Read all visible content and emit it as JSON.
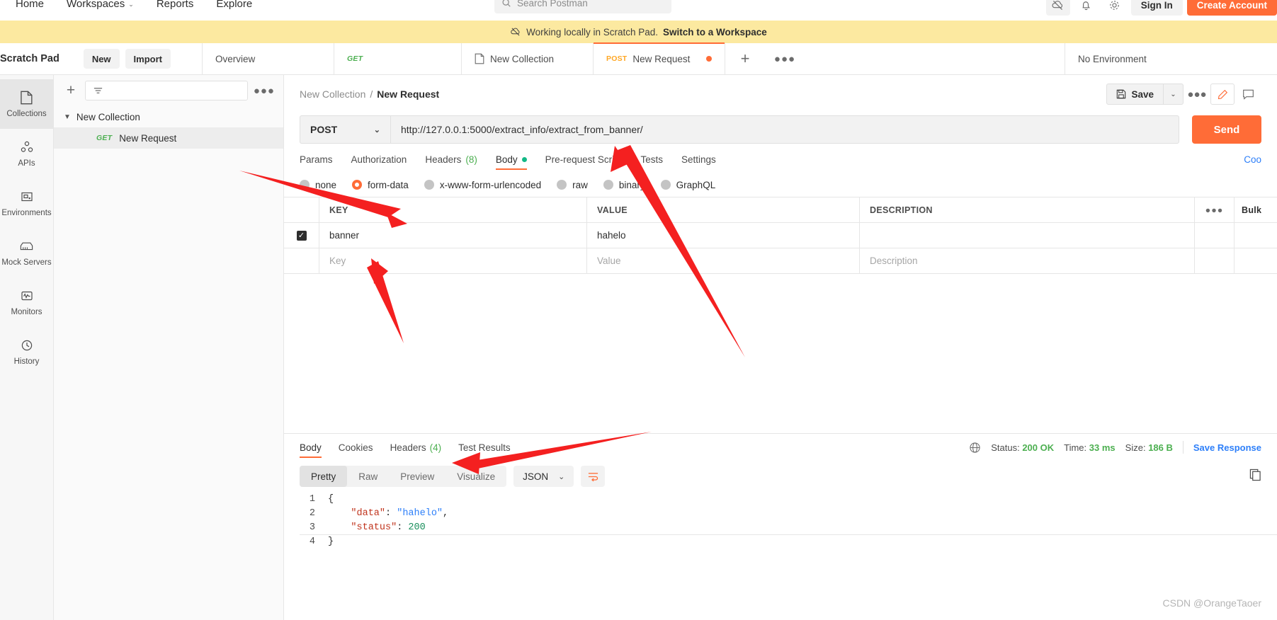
{
  "topnav": {
    "items": [
      {
        "label": "Home",
        "caret": false
      },
      {
        "label": "Workspaces",
        "caret": true
      },
      {
        "label": "Reports",
        "caret": false
      },
      {
        "label": "Explore",
        "caret": false
      }
    ],
    "caret_glyph": "⌄",
    "search_placeholder": "Search Postman",
    "search_icon": "search-icon",
    "sign_in": "Sign In",
    "create_account": "Create Account"
  },
  "banner": {
    "text": "Working locally in Scratch Pad.",
    "link": "Switch to a Workspace",
    "icon": "cloud-offline-icon",
    "color": "#fce9a0"
  },
  "header": {
    "scratch_pad_title": "Scratch Pad",
    "new_button": "New",
    "import_button": "Import",
    "more_icon": "more-horizontal-icon",
    "environment": "No Environment"
  },
  "tabs": [
    {
      "label": "Overview",
      "method": "",
      "icon": "",
      "active": false,
      "dirty": false
    },
    {
      "label": "",
      "method": "GET",
      "icon": "",
      "active": false,
      "dirty": false
    },
    {
      "label": "New Collection",
      "method": "",
      "icon": "collection-icon",
      "active": false,
      "dirty": false
    },
    {
      "label": "New Request",
      "method": "POST",
      "icon": "",
      "active": true,
      "dirty": true
    }
  ],
  "rail": [
    {
      "label": "Collections",
      "icon": "collections-icon",
      "active": true
    },
    {
      "label": "APIs",
      "icon": "apis-icon",
      "active": false
    },
    {
      "label": "Environments",
      "icon": "environments-icon",
      "active": false
    },
    {
      "label": "Mock Servers",
      "icon": "mock-servers-icon",
      "active": false
    },
    {
      "label": "Monitors",
      "icon": "monitors-icon",
      "active": false
    },
    {
      "label": "History",
      "icon": "history-icon",
      "active": false
    }
  ],
  "sidebar": {
    "filter_placeholder": "",
    "plus_icon": "plus-icon",
    "filter_icon": "filter-icon",
    "more_icon": "more-horizontal-icon",
    "collection": "New Collection",
    "request": {
      "method": "GET",
      "name": "New Request"
    }
  },
  "breadcrumb": {
    "collection": "New Collection",
    "separator": "/",
    "request": "New Request",
    "save_label": "Save",
    "save_icon": "save-disk-icon",
    "save_caret": "⌄",
    "more_icon": "more-horizontal-icon",
    "edit_icon": "pencil-icon",
    "comment_icon": "comment-icon"
  },
  "request": {
    "method": "POST",
    "method_caret": "⌄",
    "url": "http://127.0.0.1:5000/extract_info/extract_from_banner/",
    "send_label": "Send",
    "tabs": [
      {
        "label": "Params",
        "count": "",
        "active": false,
        "dot": false
      },
      {
        "label": "Authorization",
        "count": "",
        "active": false,
        "dot": false
      },
      {
        "label": "Headers",
        "count": "(8)",
        "active": false,
        "dot": false
      },
      {
        "label": "Body",
        "count": "",
        "active": true,
        "dot": true
      },
      {
        "label": "Pre-request Script",
        "count": "",
        "active": false,
        "dot": false
      },
      {
        "label": "Tests",
        "count": "",
        "active": false,
        "dot": false
      },
      {
        "label": "Settings",
        "count": "",
        "active": false,
        "dot": false
      }
    ],
    "cookies_link": "Coo",
    "body_types": [
      {
        "label": "none",
        "selected": false
      },
      {
        "label": "form-data",
        "selected": true
      },
      {
        "label": "x-www-form-urlencoded",
        "selected": false
      },
      {
        "label": "raw",
        "selected": false
      },
      {
        "label": "binary",
        "selected": false
      },
      {
        "label": "GraphQL",
        "selected": false
      }
    ],
    "table": {
      "headers": [
        "KEY",
        "VALUE",
        "DESCRIPTION"
      ],
      "more_icon": "more-horizontal-icon",
      "bulk_label": "Bulk",
      "rows": [
        {
          "checked": true,
          "key": "banner",
          "value": "hahelo",
          "description": "",
          "placeholder": false
        }
      ],
      "placeholder_row": {
        "key": "Key",
        "value": "Value",
        "description": "Description"
      },
      "check_glyph": "✓"
    }
  },
  "response": {
    "tabs": [
      {
        "label": "Body",
        "count": "",
        "active": true
      },
      {
        "label": "Cookies",
        "count": "",
        "active": false
      },
      {
        "label": "Headers",
        "count": "(4)",
        "active": false
      },
      {
        "label": "Test Results",
        "count": "",
        "active": false
      }
    ],
    "globe_icon": "globe-icon",
    "status_label": "Status:",
    "status_value": "200 OK",
    "time_label": "Time:",
    "time_value": "33 ms",
    "size_label": "Size:",
    "size_value": "186 B",
    "save_response": "Save Response",
    "view_modes": [
      {
        "label": "Pretty",
        "active": true
      },
      {
        "label": "Raw",
        "active": false
      },
      {
        "label": "Preview",
        "active": false
      },
      {
        "label": "Visualize",
        "active": false
      }
    ],
    "format": "JSON",
    "format_caret": "⌄",
    "wrap_icon": "word-wrap-icon",
    "copy_icon": "copy-icon",
    "body_lines": [
      {
        "no": "1",
        "tokens": [
          {
            "t": "{",
            "c": "p"
          }
        ]
      },
      {
        "no": "2",
        "tokens": [
          {
            "t": "    ",
            "c": "p"
          },
          {
            "t": "\"data\"",
            "c": "k"
          },
          {
            "t": ": ",
            "c": "p"
          },
          {
            "t": "\"hahelo\"",
            "c": "s"
          },
          {
            "t": ",",
            "c": "p"
          }
        ]
      },
      {
        "no": "3",
        "tokens": [
          {
            "t": "    ",
            "c": "p"
          },
          {
            "t": "\"status\"",
            "c": "k"
          },
          {
            "t": ": ",
            "c": "p"
          },
          {
            "t": "200",
            "c": "n"
          }
        ]
      },
      {
        "no": "4",
        "tokens": [
          {
            "t": "}",
            "c": "p"
          }
        ]
      }
    ]
  },
  "watermark": "CSDN @OrangeTaoer",
  "colors": {
    "accent": "#ff6c37",
    "banner": "#fce9a0",
    "green": "#4caf50",
    "blue": "#2d7ff9",
    "annotation_arrow": "#f42020"
  }
}
